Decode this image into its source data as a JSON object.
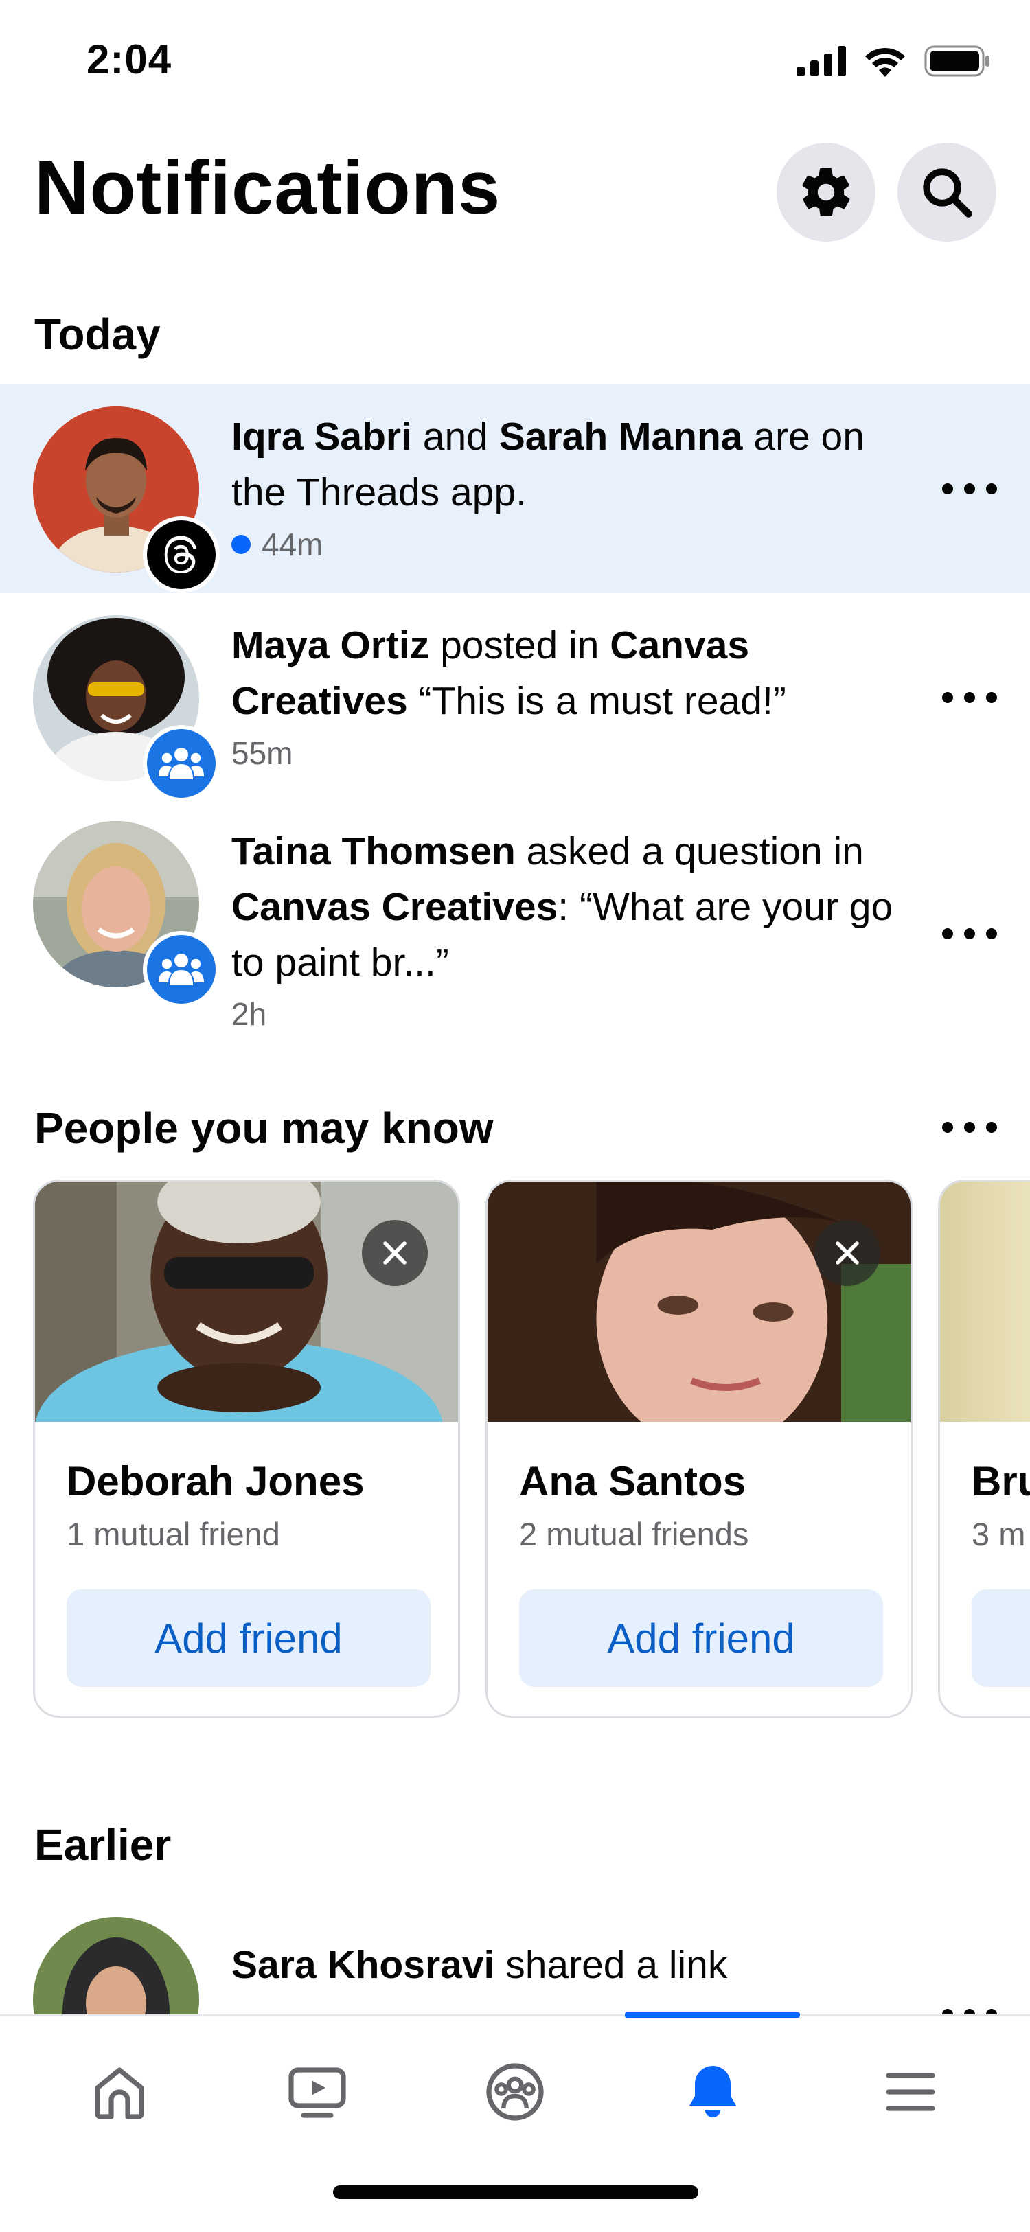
{
  "status_bar": {
    "time": "2:04"
  },
  "header": {
    "title": "Notifications",
    "settings_icon": "gear-icon",
    "search_icon": "search-icon"
  },
  "sections": {
    "today": "Today",
    "pymk": "People you may know",
    "earlier": "Earlier"
  },
  "notifications": [
    {
      "name1": "Iqra Sabri",
      "mid": " and ",
      "name2": "Sarah Manna",
      "rest": " are on the Threads app.",
      "time": "44m",
      "unread": true,
      "badge_icon": "threads-icon"
    },
    {
      "name1": "Maya Ortiz",
      "mid": " posted in ",
      "name2": "Canvas Creatives",
      "rest": " “This is a must read!”",
      "time": "55m",
      "unread": false,
      "badge_icon": "groups-icon"
    },
    {
      "name1": "Taina Thomsen",
      "mid": " asked a question in ",
      "name2": "Canvas Creatives",
      "rest": ": “What are your go to paint br...”",
      "time": "2h",
      "unread": false,
      "badge_icon": "groups-icon"
    }
  ],
  "earlier_notifications": [
    {
      "name1": "Sara Khosravi",
      "rest": " shared a link"
    }
  ],
  "pymk": [
    {
      "name": "Deborah Jones",
      "mutual": "1 mutual friend",
      "button": "Add friend"
    },
    {
      "name": "Ana Santos",
      "mutual": "2 mutual friends",
      "button": "Add friend"
    },
    {
      "name": "Bru",
      "mutual": "3 m",
      "button": ""
    }
  ],
  "bottom_nav": [
    {
      "name": "home-icon",
      "active": false
    },
    {
      "name": "video-icon",
      "active": false
    },
    {
      "name": "groups-icon",
      "active": false
    },
    {
      "name": "bell-icon",
      "active": true
    },
    {
      "name": "menu-icon",
      "active": false
    }
  ],
  "colors": {
    "accent": "#0866ff",
    "unread_bg": "#e7f0fb",
    "secondary_text": "#65676b",
    "add_friend_bg": "#e6f0fc"
  }
}
